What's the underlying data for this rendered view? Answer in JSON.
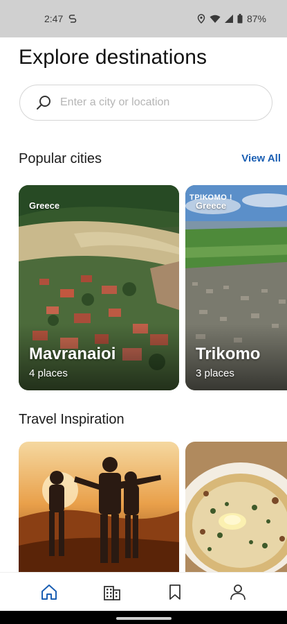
{
  "status_bar": {
    "time": "2:47",
    "battery": "87%"
  },
  "page": {
    "title": "Explore destinations"
  },
  "search": {
    "placeholder": "Enter a city or location"
  },
  "popular": {
    "title": "Popular cities",
    "view_all": "View All",
    "cards": [
      {
        "country": "Greece",
        "city": "Mavranaioi",
        "places": "4 places"
      },
      {
        "country": "Greece",
        "city": "Trikomo",
        "places": "3 places",
        "sign": "ΤΡΙΚΟΜΟ !"
      }
    ]
  },
  "inspiration": {
    "title": "Travel Inspiration"
  },
  "nav": {
    "items": [
      "home-icon",
      "city-icon",
      "bookmark-icon",
      "profile-icon"
    ],
    "active_color": "#1b5fb3"
  },
  "colors": {
    "accent": "#1b5fb3"
  }
}
